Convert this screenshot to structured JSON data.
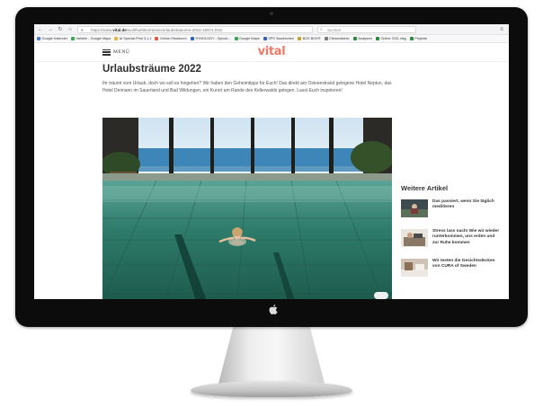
{
  "browser": {
    "url_prefix": "https://www.",
    "url_domain": "vital.de",
    "url_rest": "/wohlfuehlen/reisen/urlaubstraeume-2022-15974.html",
    "search_placeholder": "Suchen",
    "bookmarks": [
      {
        "label": "Google Kalender",
        "color": "#4a7bd6"
      },
      {
        "label": "Vahlehr - Google Maps",
        "color": "#3aa757"
      },
      {
        "label": "AI Special-Print 3.1.2",
        "color": "#e8b43a"
      },
      {
        "label": "Online-Strukturen",
        "color": "#de5b3c"
      },
      {
        "label": "SYNOLOGY - Synolo...",
        "color": "#2f64b8"
      },
      {
        "label": "Google Maps",
        "color": "#3aa757"
      },
      {
        "label": "SPS Saarkirchen",
        "color": "#2f64b8"
      },
      {
        "label": "BOX BOX®",
        "color": "#c9a227"
      },
      {
        "label": "Citrusmädner",
        "color": "#7a7a7a"
      },
      {
        "label": "Analysen",
        "color": "#2d8a3e"
      },
      {
        "label": "Online 2021.xlsg",
        "color": "#2d8a3e"
      },
      {
        "label": "Projekte",
        "color": "#2d8a3e"
      }
    ]
  },
  "site": {
    "logo": "vital",
    "menu_label": "MENÜ",
    "brand_color": "#f07a68"
  },
  "article": {
    "headline": "Urlaubsträume 2022",
    "intro": "Ihr träumt vom Urlaub, doch wo soll es hingehen? Wir haben den Geheimtipps für Euch! Das direkt am Ostseestrand gelegene Hotel Neptun, das Hotel Deimann im Sauerland und Bad Wildungen, ein Kurort am Rande des Kellerwalds gelegen. Lasst Euch inspirieren!"
  },
  "sidebar": {
    "title": "Weitere Artikel",
    "teasers": [
      {
        "title": "Das passiert, wenn Sie täglich meditieren"
      },
      {
        "title": "Stress lass nach! Wie wir wieder runterkommen, uns erden und zur Ruhe kommen"
      },
      {
        "title": "Wir testen die Gesichtsdecken von CURA of Sweden"
      }
    ]
  }
}
